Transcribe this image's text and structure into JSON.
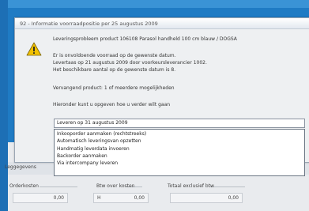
{
  "dialog": {
    "title": "92 - Informatie voorraadpositie per 25 augustus 2009",
    "icon": "warning-icon",
    "messages": [
      "Leveringsprobleem product 106108 Parasol handheld 100 cm blauw / DOGSA",
      "Er is onvoldoende voorraad op de gewenste datum.",
      "Levertaas op 21 augustus 2009 door voorkeursleverancier 1002.",
      "Het beschikbare aantal op de gewenste datum is 8.",
      "Vervangend product: 1 of meerdere mogelijkheden",
      "Hieronder kunt u opgeven hoe u verder wilt gaan"
    ],
    "select_value": "Leveren op 31 augustus 2009",
    "options": [
      "Inkooporder aanmaken (rechtstreeks)",
      "Automatisch leveringsvan opzetten",
      "Handmatig leverdata invoeren",
      "Backorder aanmaken",
      "Via intercompany leveren"
    ]
  },
  "under": {
    "label_left": "Leggegevens",
    "orderkosten_label": "Orderkosten",
    "orderkosten_value": "0,00",
    "btw_label": "Btw over kosten",
    "btw_value": "0,00",
    "btw_code": "H",
    "totaal_label": "Totaal exclusief btw",
    "totaal_value": "0,00"
  },
  "colors": {
    "desktop": "#1f7bc4",
    "warning": "#f2c200"
  }
}
